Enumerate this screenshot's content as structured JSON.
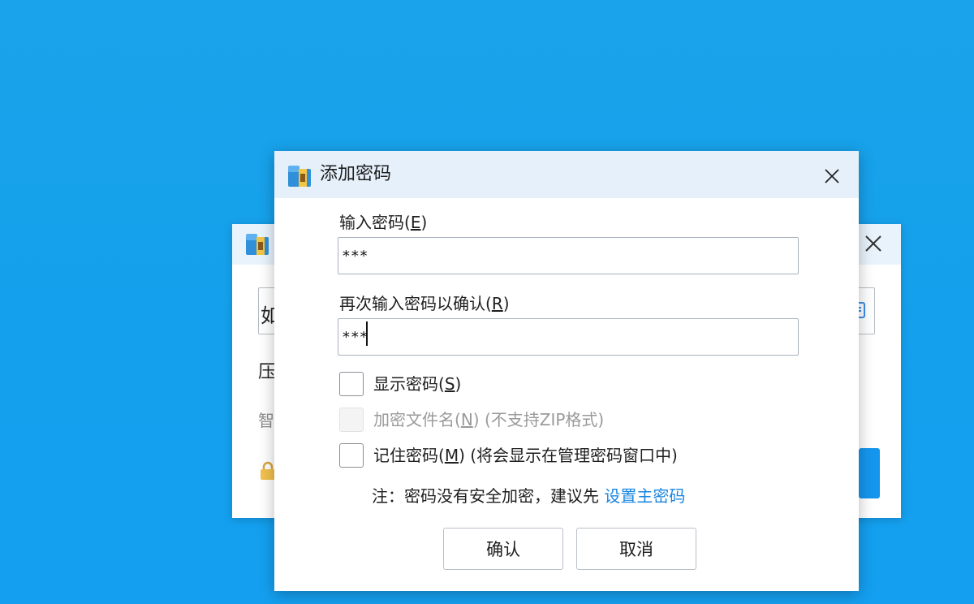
{
  "background_window": {
    "input_partial_text": "如",
    "label_partial_a": "压",
    "label_partial_b": "智"
  },
  "dialog": {
    "title": "添加密码",
    "password_label_prefix": "输入密码(",
    "password_label_key": "E",
    "password_label_suffix": ")",
    "password_value": "***",
    "confirm_label_prefix": "再次输入密码以确认(",
    "confirm_label_key": "R",
    "confirm_label_suffix": ")",
    "confirm_value": "***",
    "show_password_prefix": "显示密码(",
    "show_password_key": "S",
    "show_password_suffix": ")",
    "encrypt_names_prefix": "加密文件名(",
    "encrypt_names_key": "N",
    "encrypt_names_suffix": ") (不支持ZIP格式)",
    "remember_prefix": "记住密码(",
    "remember_key": "M",
    "remember_suffix": ") (将会显示在管理密码窗口中)",
    "note_text": "注：密码没有安全加密，建议先 ",
    "note_link": "设置主密码",
    "ok_label": "确认",
    "cancel_label": "取消"
  },
  "colors": {
    "desktop": "#1aa3ea",
    "titlebar": "#e6f0fa",
    "link": "#1a86e0",
    "accent_button": "#1596ee"
  },
  "icons": {
    "app": "winrar-archive-icon",
    "close": "close-icon",
    "lock": "lock-icon",
    "browse": "browse-icon"
  }
}
